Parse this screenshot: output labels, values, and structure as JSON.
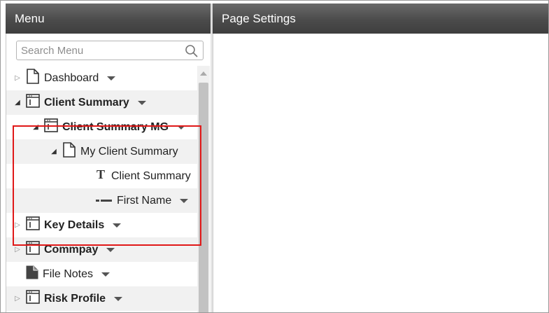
{
  "menu": {
    "title": "Menu",
    "search_placeholder": "Search Menu",
    "items": [
      {
        "label": "Dashboard",
        "level": 0,
        "expander": "collapsed",
        "icon": "page-icon",
        "bold": false,
        "dropdown": true
      },
      {
        "label": "Client Summary",
        "level": 0,
        "expander": "expanded",
        "icon": "container-icon",
        "bold": true,
        "dropdown": true
      },
      {
        "label": "Client Summary MG",
        "level": 1,
        "expander": "expanded",
        "icon": "container-icon",
        "bold": true,
        "dropdown": true
      },
      {
        "label": "My Client Summary",
        "level": 2,
        "expander": "expanded",
        "icon": "page-icon",
        "bold": false,
        "dropdown": false
      },
      {
        "label": "Client Summary",
        "level": 3,
        "expander": "none",
        "icon": "text-icon",
        "bold": false,
        "dropdown": false
      },
      {
        "label": "First Name",
        "level": 3,
        "expander": "none",
        "icon": "field-icon",
        "bold": false,
        "dropdown": true
      },
      {
        "label": "Key Details",
        "level": 0,
        "expander": "collapsed",
        "icon": "container-icon",
        "bold": true,
        "dropdown": true
      },
      {
        "label": "Commpay",
        "level": 0,
        "expander": "collapsed",
        "icon": "container-icon",
        "bold": true,
        "dropdown": true
      },
      {
        "label": "File Notes",
        "level": 0,
        "expander": "none",
        "icon": "page-filled-icon",
        "bold": false,
        "dropdown": true
      },
      {
        "label": "Risk Profile",
        "level": 0,
        "expander": "collapsed",
        "icon": "container-icon",
        "bold": true,
        "dropdown": true
      }
    ]
  },
  "page_settings": {
    "title": "Page Settings"
  },
  "colors": {
    "header_bg": "#4b4b4b",
    "highlight": "#e01818",
    "row_alt": "#f1f1f1"
  }
}
